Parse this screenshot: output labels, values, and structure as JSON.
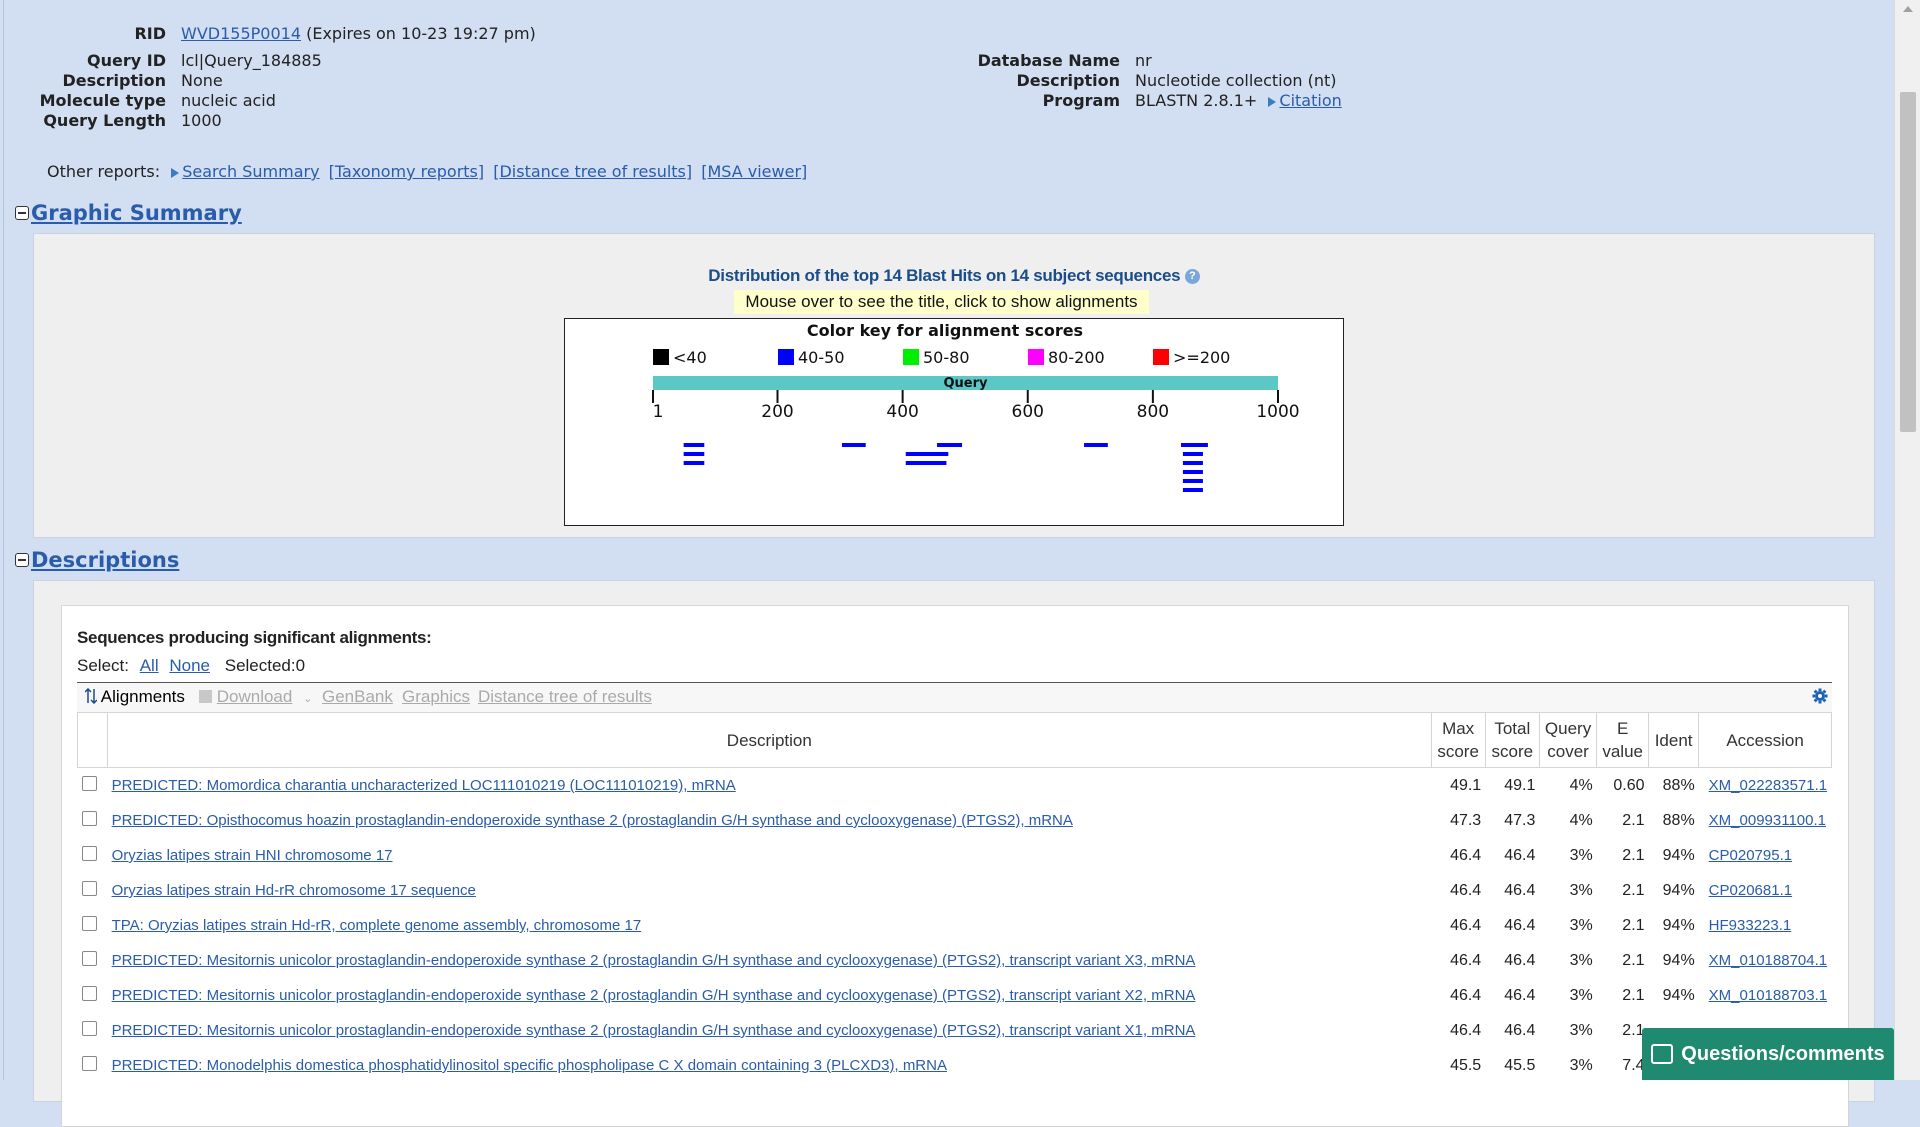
{
  "job": {
    "rid_label": "RID",
    "rid": "WVD155P0014",
    "rid_expiry": "(Expires on 10-23 19:27 pm)",
    "left": [
      {
        "k": "Query ID",
        "v": "lcl|Query_184885"
      },
      {
        "k": "Description",
        "v": "None"
      },
      {
        "k": "Molecule type",
        "v": "nucleic acid"
      },
      {
        "k": "Query Length",
        "v": "1000"
      }
    ],
    "right": [
      {
        "k": "Database Name",
        "v": "nr"
      },
      {
        "k": "Description",
        "v": "Nucleotide collection (nt)"
      },
      {
        "k": "Program",
        "v": "BLASTN 2.8.1+"
      }
    ],
    "citation_label": "Citation"
  },
  "other_reports": {
    "label": "Other reports:",
    "search_summary": "Search Summary",
    "taxonomy": "[Taxonomy reports]",
    "distance_tree": "[Distance tree of results]",
    "msa": "[MSA viewer]"
  },
  "graphic_summary": {
    "section_title": "Graphic Summary",
    "title": "Distribution of the top 14 Blast Hits on 14 subject sequences",
    "hint": "Mouse over to see the title, click to show alignments",
    "color_key_title": "Color key for alignment scores",
    "color_key": [
      {
        "label": "<40",
        "color": "#000000"
      },
      {
        "label": "40-50",
        "color": "#0000ff"
      },
      {
        "label": "50-80",
        "color": "#00ee00"
      },
      {
        "label": "80-200",
        "color": "#ff00ff"
      },
      {
        "label": ">=200",
        "color": "#ff0000"
      }
    ],
    "query_label": "Query",
    "query_length": 1000,
    "ticks": [
      "1",
      "200",
      "400",
      "600",
      "800",
      "1000"
    ],
    "tick_values": [
      1,
      200,
      400,
      600,
      800,
      1000
    ],
    "query_bar_color": "#5bc8c6",
    "hit_color": "#0000ff",
    "hits": [
      {
        "start": 690,
        "end": 728
      },
      {
        "start": 455,
        "end": 495
      },
      {
        "start": 303,
        "end": 341
      },
      {
        "start": 845,
        "end": 888
      },
      {
        "start": 50,
        "end": 83
      },
      {
        "start": 50,
        "end": 83
      },
      {
        "start": 50,
        "end": 83
      },
      {
        "start": 405,
        "end": 473
      },
      {
        "start": 405,
        "end": 470
      },
      {
        "start": 848,
        "end": 880
      },
      {
        "start": 848,
        "end": 880
      },
      {
        "start": 848,
        "end": 880
      },
      {
        "start": 848,
        "end": 880
      },
      {
        "start": 848,
        "end": 880
      }
    ],
    "hit_rows": [
      0,
      0,
      0,
      0,
      0,
      1,
      2,
      1,
      2,
      1,
      2,
      3,
      4,
      5
    ]
  },
  "descriptions": {
    "section_title": "Descriptions",
    "heading": "Sequences producing significant alignments:",
    "select_label": "Select:",
    "select_all": "All",
    "select_none": "None",
    "selected": "Selected:0",
    "toolbar": {
      "alignments": "Alignments",
      "download": "Download",
      "genbank": "GenBank",
      "graphics": "Graphics",
      "distance_tree": "Distance tree of results"
    },
    "columns": {
      "description": "Description",
      "max_score": [
        "Max",
        "score"
      ],
      "total_score": [
        "Total",
        "score"
      ],
      "query_cover": [
        "Query",
        "cover"
      ],
      "e_value": [
        "E",
        "value"
      ],
      "ident": "Ident",
      "accession": "Accession"
    },
    "rows": [
      {
        "desc": "PREDICTED: Momordica charantia uncharacterized LOC111010219 (LOC111010219), mRNA",
        "max": "49.1",
        "total": "49.1",
        "cover": "4%",
        "e": "0.60",
        "ident": "88%",
        "acc": "XM_022283571.1"
      },
      {
        "desc": "PREDICTED: Opisthocomus hoazin prostaglandin-endoperoxide synthase 2 (prostaglandin G/H synthase and cyclooxygenase) (PTGS2), mRNA",
        "max": "47.3",
        "total": "47.3",
        "cover": "4%",
        "e": "2.1",
        "ident": "88%",
        "acc": "XM_009931100.1"
      },
      {
        "desc": "Oryzias latipes strain HNI chromosome 17",
        "max": "46.4",
        "total": "46.4",
        "cover": "3%",
        "e": "2.1",
        "ident": "94%",
        "acc": "CP020795.1"
      },
      {
        "desc": "Oryzias latipes strain Hd-rR chromosome 17 sequence",
        "max": "46.4",
        "total": "46.4",
        "cover": "3%",
        "e": "2.1",
        "ident": "94%",
        "acc": "CP020681.1"
      },
      {
        "desc": "TPA: Oryzias latipes strain Hd-rR, complete genome assembly, chromosome 17",
        "max": "46.4",
        "total": "46.4",
        "cover": "3%",
        "e": "2.1",
        "ident": "94%",
        "acc": "HF933223.1"
      },
      {
        "desc": "PREDICTED: Mesitornis unicolor prostaglandin-endoperoxide synthase 2 (prostaglandin G/H synthase and cyclooxygenase) (PTGS2), transcript variant X3, mRNA",
        "max": "46.4",
        "total": "46.4",
        "cover": "3%",
        "e": "2.1",
        "ident": "94%",
        "acc": "XM_010188704.1"
      },
      {
        "desc": "PREDICTED: Mesitornis unicolor prostaglandin-endoperoxide synthase 2 (prostaglandin G/H synthase and cyclooxygenase) (PTGS2), transcript variant X2, mRNA",
        "max": "46.4",
        "total": "46.4",
        "cover": "3%",
        "e": "2.1",
        "ident": "94%",
        "acc": "XM_010188703.1"
      },
      {
        "desc": "PREDICTED: Mesitornis unicolor prostaglandin-endoperoxide synthase 2 (prostaglandin G/H synthase and cyclooxygenase) (PTGS2), transcript variant X1, mRNA",
        "max": "46.4",
        "total": "46.4",
        "cover": "3%",
        "e": "2.1",
        "ident": "",
        "acc": ""
      },
      {
        "desc": "PREDICTED: Monodelphis domestica phosphatidylinositol specific phospholipase C X domain containing 3 (PLCXD3), mRNA",
        "max": "45.5",
        "total": "45.5",
        "cover": "3%",
        "e": "7.4",
        "ident": "",
        "acc": ""
      }
    ]
  },
  "feedback_button": "Questions/comments"
}
